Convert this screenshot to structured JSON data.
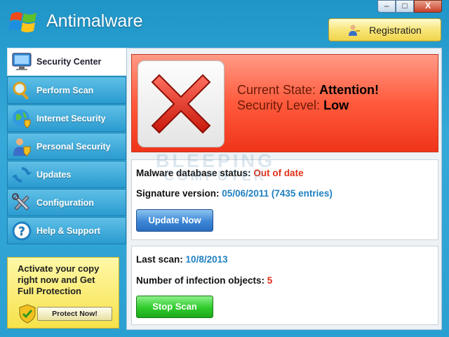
{
  "window": {
    "title": "Antimalware",
    "controls": {
      "minimize": "–",
      "maximize": "□",
      "close": "X"
    }
  },
  "header": {
    "registration_label": "Registration",
    "registration_icon": "user-key-icon"
  },
  "sidebar": {
    "items": [
      {
        "label": "Security Center",
        "icon": "monitor-icon",
        "active": true
      },
      {
        "label": "Perform Scan",
        "icon": "magnifier-icon"
      },
      {
        "label": "Internet Security",
        "icon": "globe-shield-icon"
      },
      {
        "label": "Personal Security",
        "icon": "person-shield-icon"
      },
      {
        "label": "Updates",
        "icon": "refresh-icon"
      },
      {
        "label": "Configuration",
        "icon": "tools-icon"
      },
      {
        "label": "Help & Support",
        "icon": "help-icon"
      }
    ]
  },
  "promo": {
    "line1": "Activate your copy",
    "line2": "right now and Get",
    "line3": "Full Protection",
    "button_label": "Protect Now!"
  },
  "alert": {
    "state_label": "Current State:",
    "state_value": "Attention!",
    "level_label": "Security Level:",
    "level_value": "Low"
  },
  "database": {
    "status_label": "Malware database status:",
    "status_value": "Out of date",
    "signature_label": "Signature version:",
    "signature_value": "05/06/2011 (7435 entries)",
    "update_button": "Update Now"
  },
  "scan": {
    "last_scan_label": "Last scan:",
    "last_scan_value": "10/8/2013",
    "infections_label": "Number of infection objects:",
    "infections_value": "5",
    "stop_button": "Stop Scan"
  },
  "watermark": {
    "line1": "BLEEPING",
    "line2": "COMPUTER"
  },
  "colors": {
    "accent_blue": "#2a9bd0",
    "alert_red": "#f0341a",
    "value_red": "#e0301a",
    "value_blue": "#1f7fc0"
  }
}
